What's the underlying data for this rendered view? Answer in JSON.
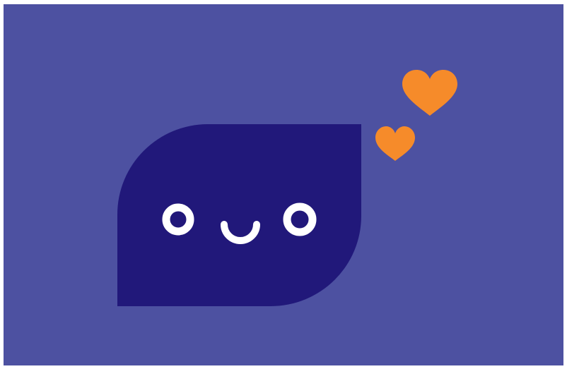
{
  "illustration": {
    "subject": "chat-bubble-character-with-hearts",
    "icons": [
      "speech-bubble-icon",
      "heart-icon",
      "heart-icon"
    ]
  },
  "colors": {
    "background": "#4d51a1",
    "bubble": "#21187a",
    "face": "#ffffff",
    "hearts": "#f68b2a",
    "page": "#ffffff"
  }
}
